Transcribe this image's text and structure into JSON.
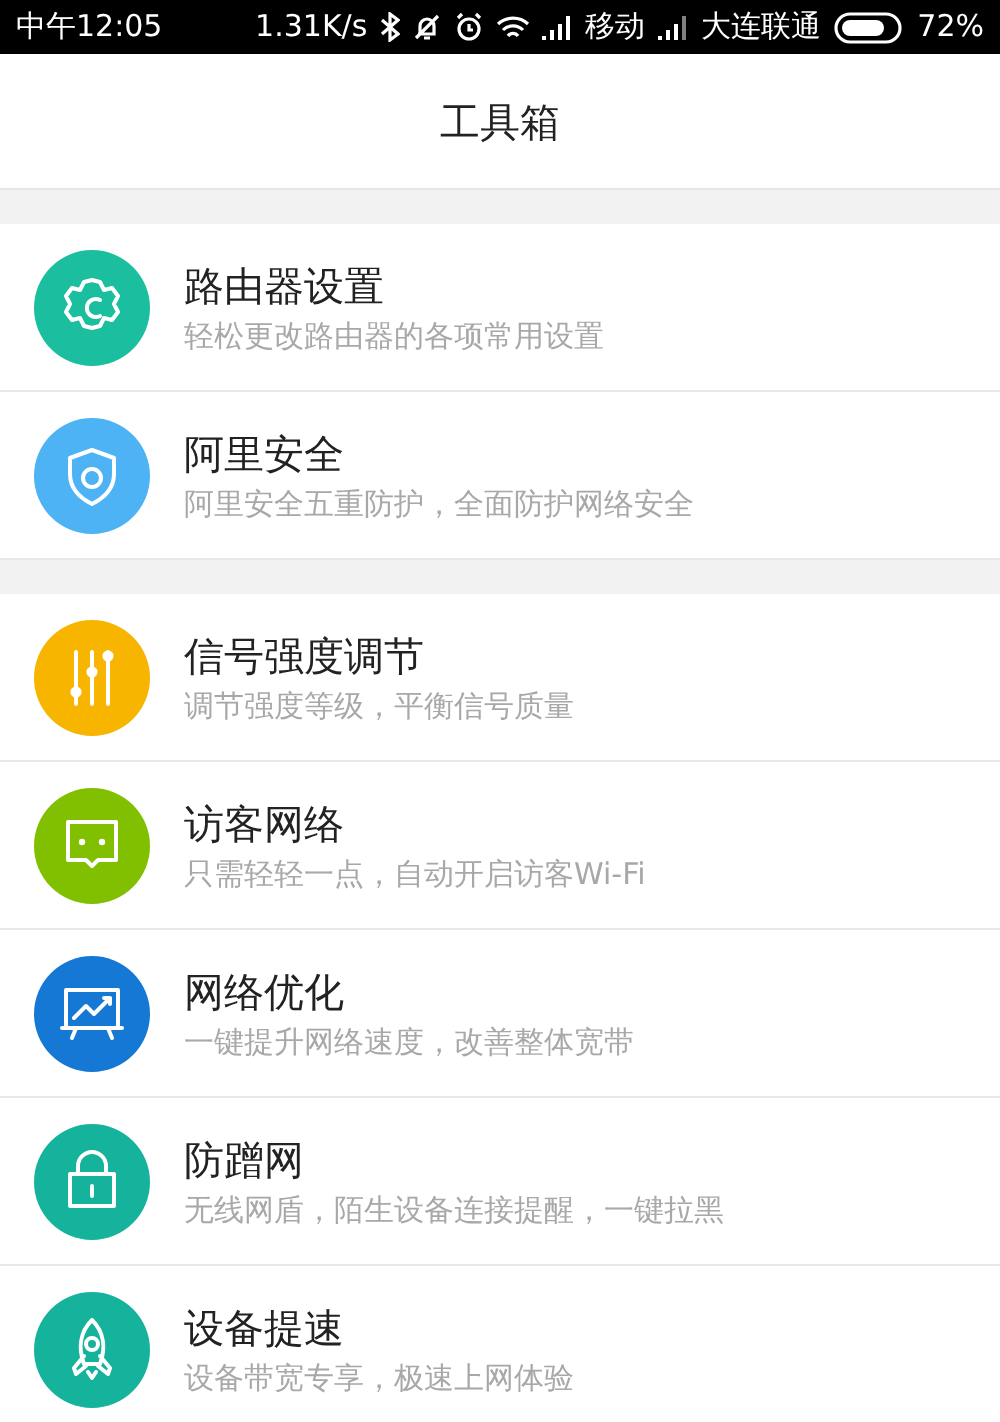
{
  "status_bar": {
    "time": "中午12:05",
    "speed": "1.31K/s",
    "carrier_1": "移动",
    "carrier_2": "大连联通",
    "battery": "72%"
  },
  "header": {
    "title": "工具箱"
  },
  "sections": [
    {
      "items": [
        {
          "kind": "gear",
          "color": "#1bbf9f",
          "title": "路由器设置",
          "subtitle": "轻松更改路由器的各项常用设置"
        },
        {
          "kind": "shield",
          "color": "#4db3f5",
          "title": "阿里安全",
          "subtitle": "阿里安全五重防护，全面防护网络安全"
        }
      ]
    },
    {
      "items": [
        {
          "kind": "sliders",
          "color": "#f7b500",
          "title": "信号强度调节",
          "subtitle": "调节强度等级，平衡信号质量"
        },
        {
          "kind": "chat",
          "color": "#80c000",
          "title": "访客网络",
          "subtitle": "只需轻轻一点，自动开启访客Wi-Fi"
        },
        {
          "kind": "chart",
          "color": "#1478d4",
          "title": "网络优化",
          "subtitle": "一键提升网络速度，改善整体宽带"
        },
        {
          "kind": "lock",
          "color": "#16b39c",
          "title": "防蹭网",
          "subtitle": "无线网盾，陌生设备连接提醒，一键拉黑"
        },
        {
          "kind": "rocket",
          "color": "#16b39c",
          "title": "设备提速",
          "subtitle": "设备带宽专享，极速上网体验"
        }
      ]
    }
  ]
}
